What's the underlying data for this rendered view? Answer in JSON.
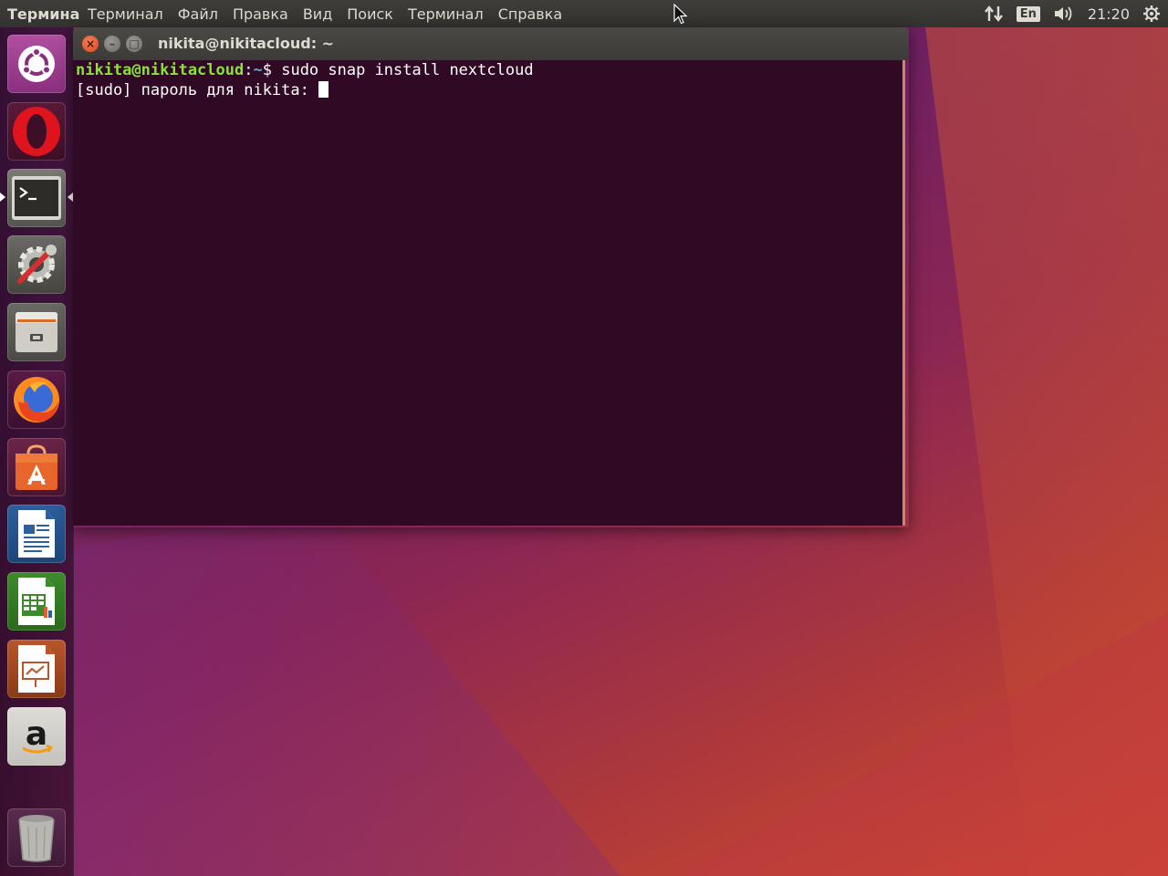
{
  "top_panel": {
    "app_title": "Терминал",
    "menu": [
      "Терминал",
      "Файл",
      "Правка",
      "Вид",
      "Поиск",
      "Терминал",
      "Справка"
    ],
    "keyboard_layout": "En",
    "clock": "21:20"
  },
  "launcher": {
    "items": [
      {
        "name": "dash-home",
        "icon": "ubuntu-logo-icon"
      },
      {
        "name": "opera",
        "icon": "opera-icon"
      },
      {
        "name": "terminal",
        "icon": "terminal-icon",
        "active": true
      },
      {
        "name": "system-settings",
        "icon": "settings-icon"
      },
      {
        "name": "files",
        "icon": "file-cabinet-icon"
      },
      {
        "name": "firefox",
        "icon": "firefox-icon"
      },
      {
        "name": "ubuntu-software",
        "icon": "software-center-icon"
      },
      {
        "name": "libreoffice-writer",
        "icon": "writer-icon"
      },
      {
        "name": "libreoffice-calc",
        "icon": "calc-icon"
      },
      {
        "name": "libreoffice-impress",
        "icon": "impress-icon"
      },
      {
        "name": "amazon",
        "icon": "amazon-icon"
      },
      {
        "name": "trash",
        "icon": "trash-icon"
      }
    ]
  },
  "terminal": {
    "window_title": "nikita@nikitacloud: ~",
    "close_glyph": "×",
    "min_glyph": "–",
    "max_glyph": "□",
    "lines": [
      {
        "prompt_user": "nikita@nikitacloud",
        "prompt_sep": ":",
        "prompt_path": "~",
        "prompt_end": "$ ",
        "command": "sudo snap install nextcloud"
      },
      {
        "text": "[sudo] пароль для nikita: "
      }
    ]
  },
  "colors": {
    "terminal_bg": "#300a24",
    "prompt_user": "#8ae234",
    "prompt_path": "#729fcf",
    "panel_bg": "#3c3b37"
  }
}
